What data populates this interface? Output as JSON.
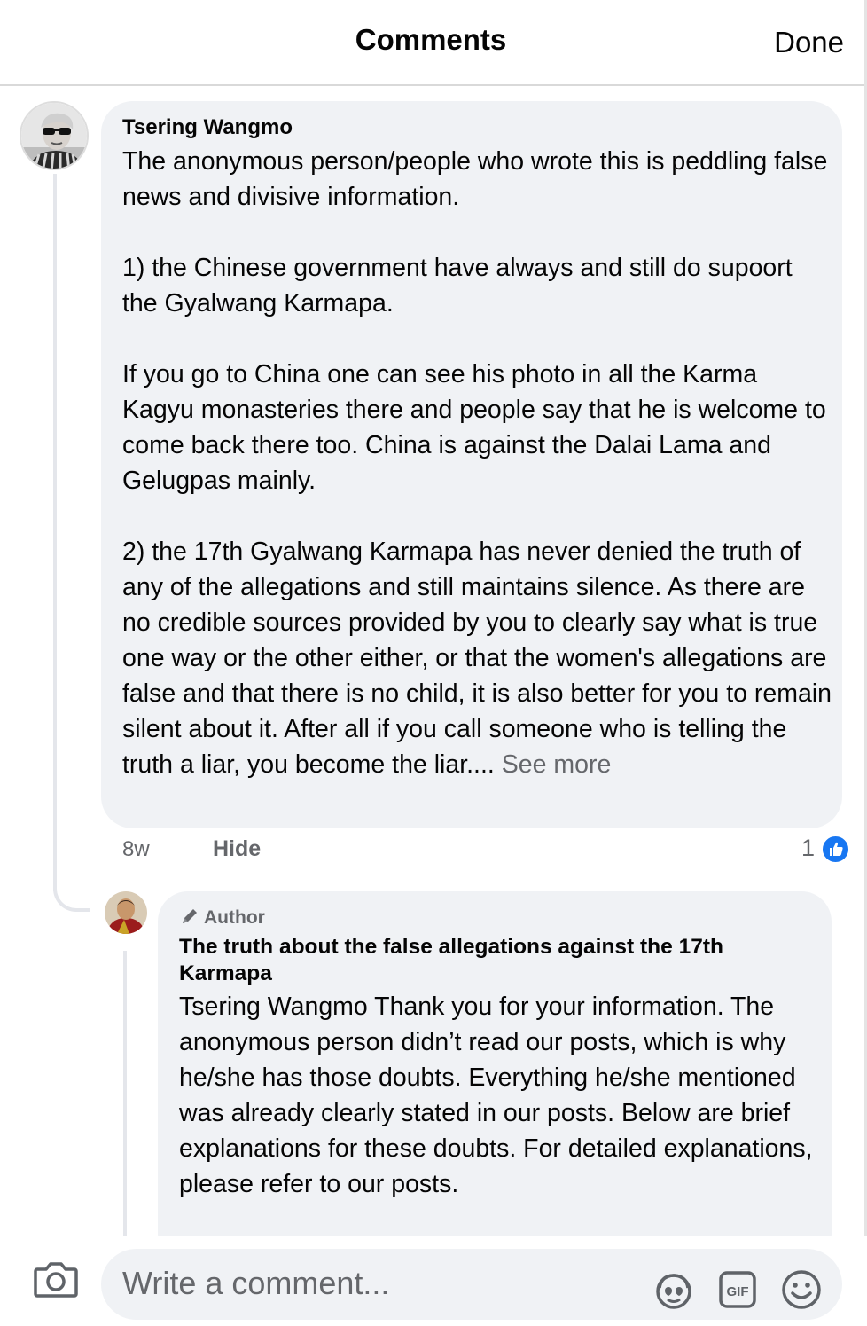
{
  "header": {
    "title": "Comments",
    "done_label": "Done"
  },
  "comment": {
    "author": "Tsering Wangmo",
    "text": "The anonymous person/people who wrote this is peddling false news and divisive information.\n\n1) the Chinese government have always and still do supoort the Gyalwang Karmapa.\n\nIf you go to China one can see his photo in all the Karma Kagyu monasteries there and people say that he is welcome to come back there too. China is against the Dalai Lama and Gelugpas mainly.\n\n2) the 17th Gyalwang Karmapa has never denied the truth of any of the allegations and still maintains silence. As there are no credible sources provided by you to clearly say what is true one way or the other either, or that the women's allegations are false and that there is no child, it is also better for you to remain silent about it. After all if you call someone who is telling the truth a liar, you become the liar.... ",
    "see_more": "See more",
    "time": "8w",
    "hide_label": "Hide",
    "like_count": "1",
    "like_icon": "thumbs-up-icon"
  },
  "reply": {
    "badge": "Author",
    "author": "The truth about the false allegations against the 17th Karmapa",
    "text": "Tsering Wangmo Thank you for your information. The anonymous person didn’t read our posts, which is why he/she has those doubts. Everything he/she mentioned was already clearly stated in our posts. Below are brief explanations for these doubts. For detailed explanations, please refer to our posts."
  },
  "composer": {
    "placeholder": "Write a comment...",
    "icons": [
      "camera-icon",
      "avatar-sticker-icon",
      "gif-icon",
      "emoji-icon"
    ]
  },
  "colors": {
    "bubble": "#f0f2f5",
    "secondary_text": "#65676b",
    "like_blue": "#1877f2"
  }
}
